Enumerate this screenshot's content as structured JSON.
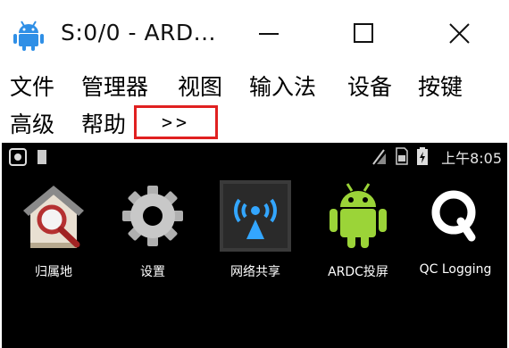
{
  "window": {
    "title": "S:0/0 - ARD...",
    "app_icon": "android-icon",
    "controls": [
      "minimize-icon",
      "maximize-icon",
      "close-icon"
    ]
  },
  "menu": {
    "items": [
      "文件",
      "管理器",
      "视图",
      "输入法",
      "设备",
      "按键",
      "高级",
      "帮助"
    ],
    "more_label": ">>",
    "highlight_color": "#e02020"
  },
  "device": {
    "status": {
      "time": "上午8:05",
      "icons": [
        "screenshot-icon",
        "sd-card-icon",
        "signal-off-icon",
        "sim-icon",
        "battery-charging-icon"
      ]
    },
    "apps": [
      {
        "label": "归属地",
        "icon": "house-magnifier-icon"
      },
      {
        "label": "设置",
        "icon": "settings-gear-icon"
      },
      {
        "label": "网络共享",
        "icon": "wifi-tethering-icon"
      },
      {
        "label": "ARDC投屏",
        "icon": "android-robot-icon"
      },
      {
        "label": "QC Logging",
        "icon": "qc-logging-icon"
      }
    ]
  }
}
